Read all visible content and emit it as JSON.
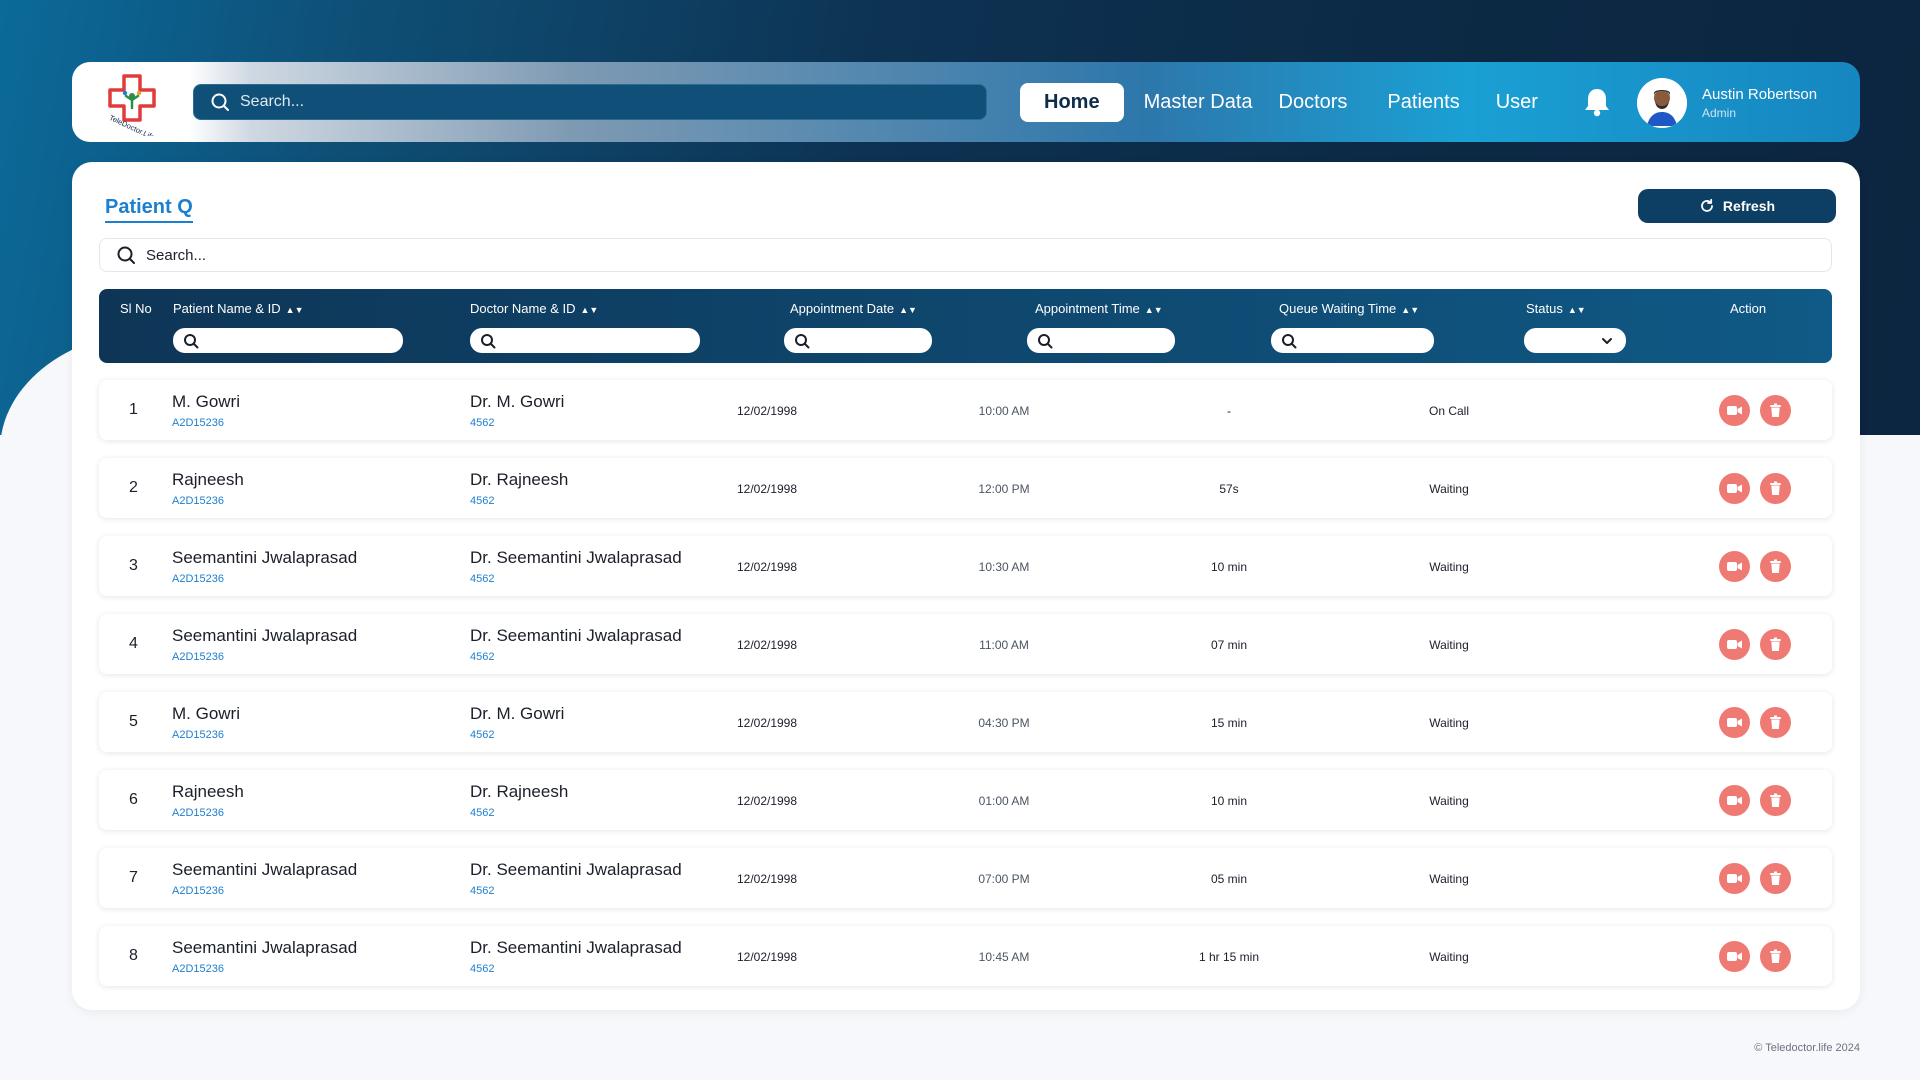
{
  "header": {
    "logo_text": "TeleDoctor.Life",
    "search_placeholder": "Search...",
    "nav": [
      "Home",
      "Master Data",
      "Doctors",
      "Patients",
      "User"
    ],
    "active_nav": "Home",
    "user_name": "Austin Robertson",
    "user_role": "Admin"
  },
  "queue": {
    "title": "Patient Q",
    "refresh_label": "Refresh",
    "search_placeholder": "Search...",
    "columns": {
      "sl": "Sl No",
      "patient": "Patient Name & ID",
      "doctor": "Doctor Name & ID",
      "date": "Appointment Date",
      "time": "Appointment Time",
      "wait": "Queue Waiting Time",
      "status": "Status",
      "action": "Action"
    },
    "rows": [
      {
        "no": "1",
        "name": "M. Gowri",
        "id": "A2D15236",
        "doctor": "Dr. M. Gowri",
        "doctor_id": "4562",
        "date": "12/02/1998",
        "time": "10:00 AM",
        "wait": "-",
        "status": "On Call"
      },
      {
        "no": "2",
        "name": "Rajneesh",
        "id": "A2D15236",
        "doctor": "Dr. Rajneesh",
        "doctor_id": "4562",
        "date": "12/02/1998",
        "time": "12:00 PM",
        "wait": "57s",
        "status": "Waiting"
      },
      {
        "no": "3",
        "name": "Seemantini Jwalaprasad",
        "id": "A2D15236",
        "doctor": "Dr. Seemantini Jwalaprasad",
        "doctor_id": "4562",
        "date": "12/02/1998",
        "time": "10:30 AM",
        "wait": "10 min",
        "status": "Waiting"
      },
      {
        "no": "4",
        "name": "Seemantini Jwalaprasad",
        "id": "A2D15236",
        "doctor": "Dr. Seemantini Jwalaprasad",
        "doctor_id": "4562",
        "date": "12/02/1998",
        "time": "11:00 AM",
        "wait": "07 min",
        "status": "Waiting"
      },
      {
        "no": "5",
        "name": "M. Gowri",
        "id": "A2D15236",
        "doctor": "Dr. M. Gowri",
        "doctor_id": "4562",
        "date": "12/02/1998",
        "time": "04:30 PM",
        "wait": "15 min",
        "status": "Waiting"
      },
      {
        "no": "6",
        "name": "Rajneesh",
        "id": "A2D15236",
        "doctor": "Dr. Rajneesh",
        "doctor_id": "4562",
        "date": "12/02/1998",
        "time": "01:00 AM",
        "wait": "10 min",
        "status": "Waiting"
      },
      {
        "no": "7",
        "name": "Seemantini Jwalaprasad",
        "id": "A2D15236",
        "doctor": "Dr. Seemantini Jwalaprasad",
        "doctor_id": "4562",
        "date": "12/02/1998",
        "time": "07:00 PM",
        "wait": "05 min",
        "status": "Waiting"
      },
      {
        "no": "8",
        "name": "Seemantini Jwalaprasad",
        "id": "A2D15236",
        "doctor": "Dr. Seemantini Jwalaprasad",
        "doctor_id": "4562",
        "date": "12/02/1998",
        "time": "10:45 AM",
        "wait": "1 hr 15 min",
        "status": "Waiting"
      }
    ]
  },
  "icons": {
    "search": "search-icon",
    "bell": "bell-icon",
    "refresh": "refresh-icon",
    "sort": "sort-icon",
    "chevron": "chevron-down-icon",
    "call": "video-call-icon",
    "delete": "trash-icon"
  },
  "colors": {
    "accent_blue": "#1d7fd0",
    "header_dark": "#0d3f64",
    "action_red": "#ef7a73"
  },
  "footer": "© Teledoctor.life 2024"
}
